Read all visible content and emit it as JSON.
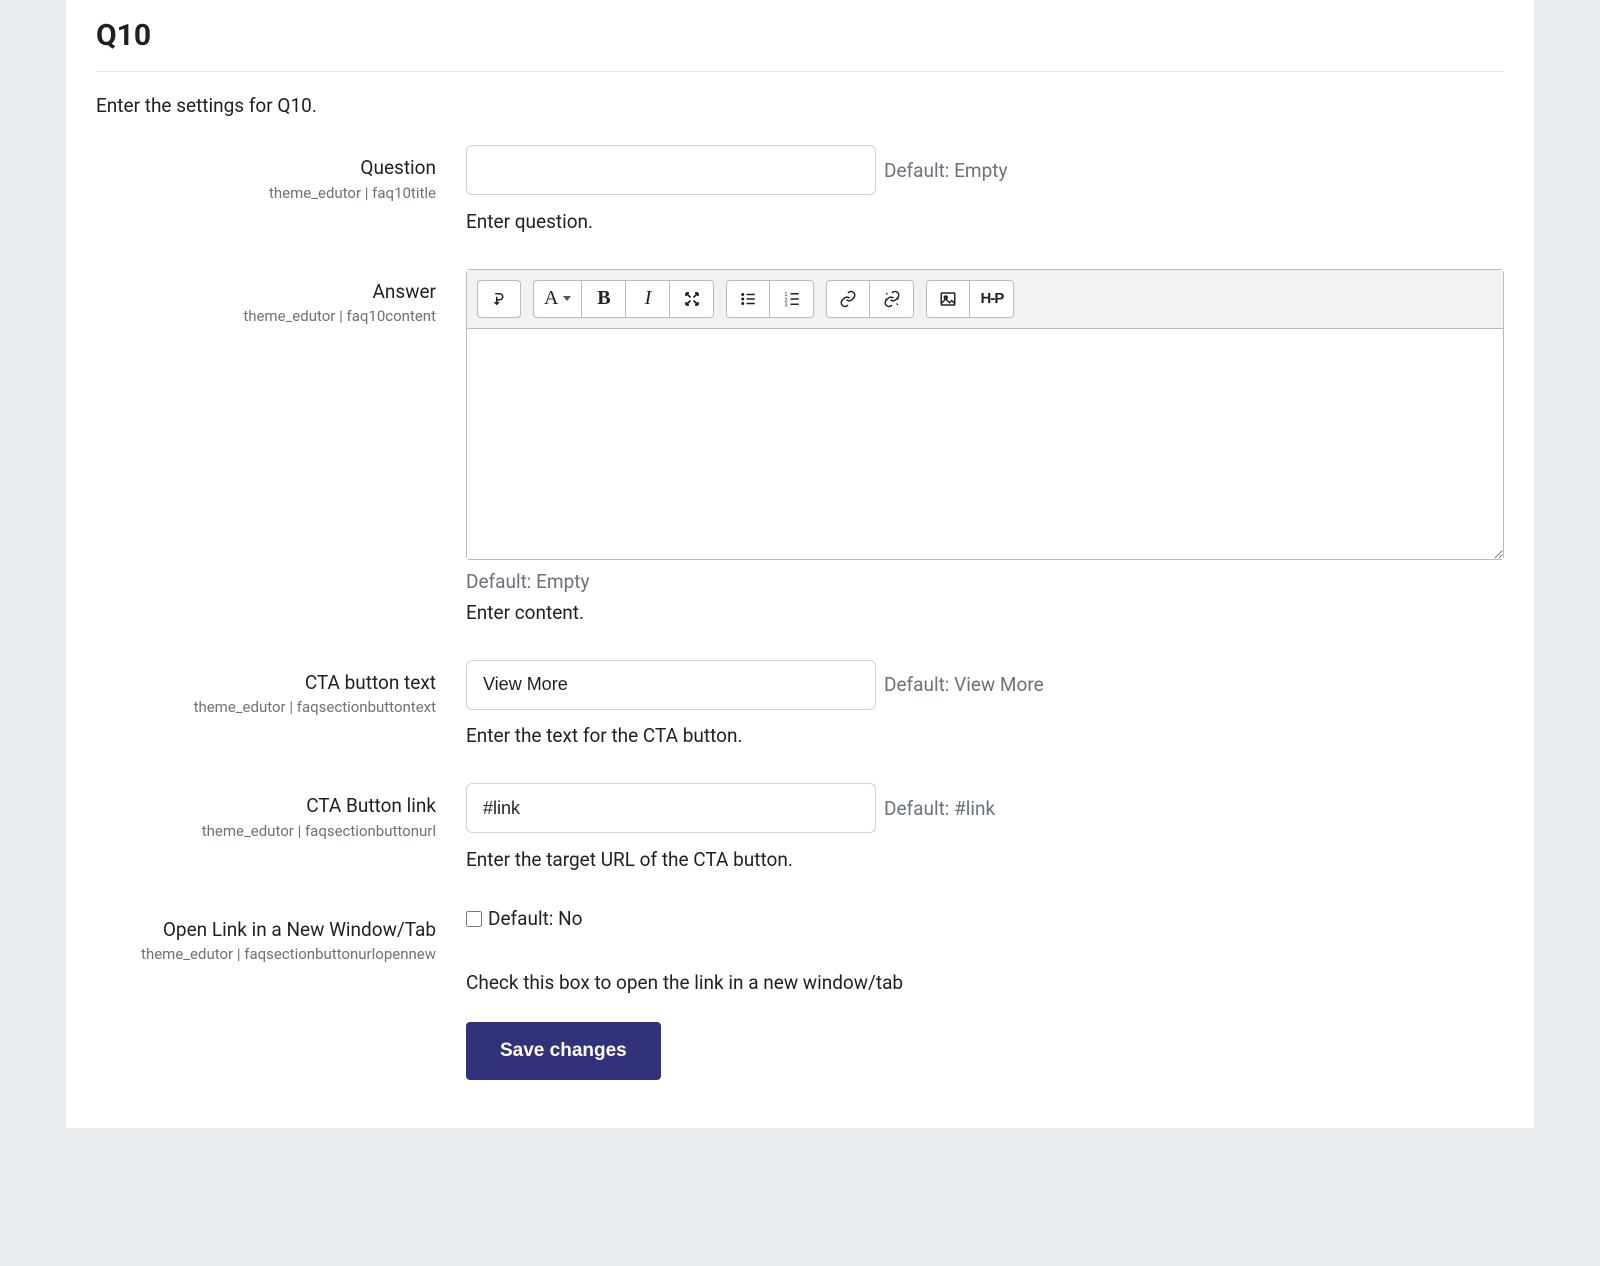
{
  "section": {
    "title": "Q10",
    "intro": "Enter the settings for Q10."
  },
  "fields": {
    "question": {
      "label": "Question",
      "sublabel": "theme_edutor | faq10title",
      "value": "",
      "default_text": "Default: Empty",
      "help": "Enter question."
    },
    "answer": {
      "label": "Answer",
      "sublabel": "theme_edutor | faq10content",
      "default_text": "Default: Empty",
      "help": "Enter content."
    },
    "cta_text": {
      "label": "CTA button text",
      "sublabel": "theme_edutor | faqsectionbuttontext",
      "value": "View More",
      "default_text": "Default: View More",
      "help": "Enter the text for the CTA button."
    },
    "cta_link": {
      "label": "CTA Button link",
      "sublabel": "theme_edutor | faqsectionbuttonurl",
      "value": "#link",
      "default_text": "Default: #link",
      "help": "Enter the target URL of the CTA button."
    },
    "open_new": {
      "label": "Open Link in a New Window/Tab",
      "sublabel": "theme_edutor | faqsectionbuttonurlopennew",
      "default_text": "Default: No",
      "help": "Check this box to open the link in a new window/tab"
    }
  },
  "editor_icons": {
    "paragraph": "A",
    "h5p": "H-P"
  },
  "buttons": {
    "save": "Save changes"
  }
}
